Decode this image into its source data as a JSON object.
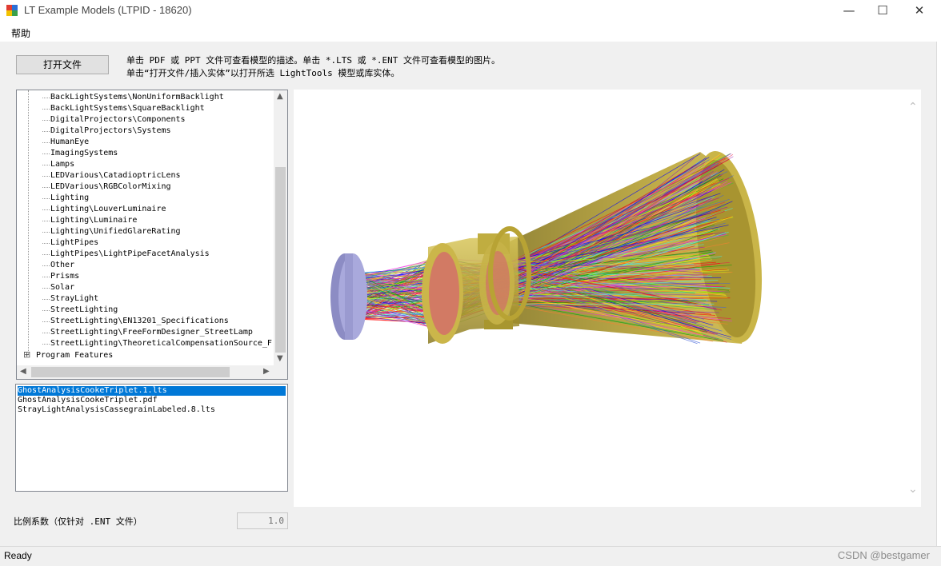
{
  "window": {
    "title": "LT Example Models (LTPID - 18620)",
    "minimize_glyph": "—",
    "maximize_glyph": "☐",
    "close_glyph": "✕"
  },
  "menu": {
    "help": "帮助"
  },
  "toolbar": {
    "open_file_label": "打开文件",
    "hint_line1": "单击 PDF 或 PPT 文件可查看模型的描述。单击 *.LTS 或 *.ENT 文件可查看模型的图片。",
    "hint_line2": "单击“打开文件/插入实体”以打开所选 LightTools 模型或库实体。"
  },
  "tree": {
    "items": [
      "BackLightSystems\\NonUniformBacklight",
      "BackLightSystems\\SquareBacklight",
      "DigitalProjectors\\Components",
      "DigitalProjectors\\Systems",
      "HumanEye",
      "ImagingSystems",
      "Lamps",
      "LEDVarious\\CatadioptricLens",
      "LEDVarious\\RGBColorMixing",
      "Lighting",
      "Lighting\\LouverLuminaire",
      "Lighting\\Luminaire",
      "Lighting\\UnifiedGlareRating",
      "LightPipes",
      "LightPipes\\LightPipeFacetAnalysis",
      "Other",
      "Prisms",
      "Solar",
      "StrayLight",
      "StreetLighting",
      "StreetLighting\\EN13201_Specifications",
      "StreetLighting\\FreeFormDesigner_StreetLamp",
      "StreetLighting\\TheoreticalCompensationSource_F"
    ],
    "root_item": "Program Features",
    "expand_glyph": "⊞"
  },
  "files": {
    "items": [
      "GhostAnalysisCookeTriplet.1.lts",
      "GhostAnalysisCookeTriplet.pdf",
      "StrayLightAnalysisCassegrainLabeled.8.lts"
    ],
    "selected_index": 0
  },
  "scale": {
    "label": "比例系数（仅针对 .ENT 文件）",
    "value": "1.0"
  },
  "status": {
    "text": "Ready"
  },
  "watermark": "CSDN @bestgamer",
  "icons": [
    "app-icon",
    "minimize-icon",
    "maximize-icon",
    "close-icon",
    "scroll-up-arrow-icon",
    "scroll-down-arrow-icon",
    "scroll-left-arrow-icon",
    "scroll-right-arrow-icon",
    "expand-plus-icon"
  ],
  "colors": {
    "selection": "#0078d7",
    "lens_gold": "#c8b446",
    "detector_lavender": "#a9a9dc",
    "cone_gold": "#c7b040"
  }
}
